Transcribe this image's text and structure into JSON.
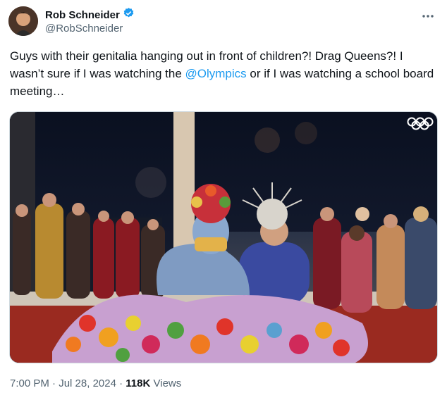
{
  "author": {
    "display_name": "Rob Schneider",
    "handle": "@RobSchneider",
    "verified": true
  },
  "tweet": {
    "text_before": "Guys with their genitalia hanging out in front of children?! Drag Queens?! I wasn’t sure if I was watching the ",
    "mention": "@Olympics",
    "text_after": " or if I was watching a school board meeting…"
  },
  "meta": {
    "time": "7:00 PM",
    "sep1": "·",
    "date": "Jul 28, 2024",
    "sep2": "·",
    "views_count": "118K",
    "views_label": "Views"
  },
  "icons": {
    "more": "more-icon",
    "verified": "verified-badge-icon",
    "olympic_rings": "olympic-rings-icon"
  },
  "colors": {
    "link": "#1d9bf0",
    "verified": "#1d9bf0",
    "secondary_text": "#536471"
  }
}
